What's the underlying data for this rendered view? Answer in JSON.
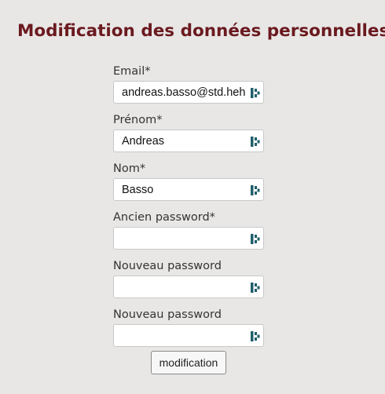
{
  "page": {
    "title": "Modification des données personnelles"
  },
  "form": {
    "fields": [
      {
        "label": "Email*",
        "value": "andreas.basso@std.heh.be",
        "type": "text"
      },
      {
        "label": "Prénom*",
        "value": "Andreas",
        "type": "text"
      },
      {
        "label": "Nom*",
        "value": "Basso",
        "type": "text"
      },
      {
        "label": "Ancien password*",
        "value": "",
        "type": "password"
      },
      {
        "label": "Nouveau password",
        "value": "",
        "type": "password"
      },
      {
        "label": "Nouveau password",
        "value": "",
        "type": "password"
      }
    ],
    "submit_label": "modification"
  },
  "icons": {
    "field_icon": "password-manager-icon"
  },
  "colors": {
    "title": "#6b1a1f",
    "background": "#e8e7e6",
    "icon": "#1f5e6b"
  }
}
